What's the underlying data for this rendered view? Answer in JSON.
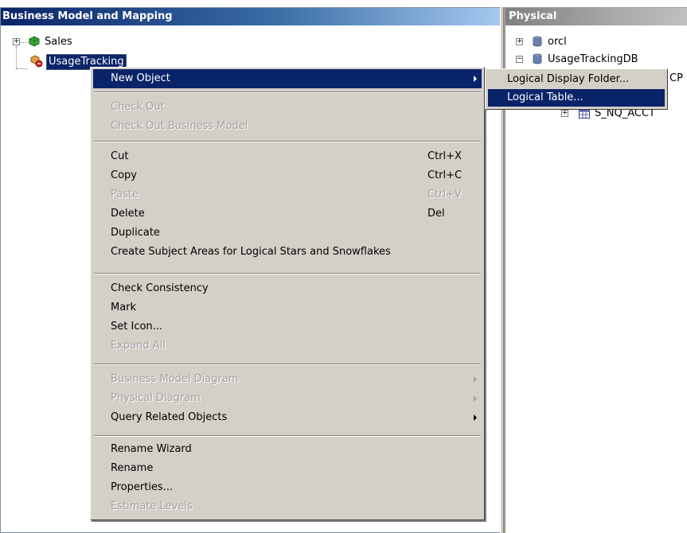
{
  "left_pane": {
    "title": "Business Model and Mapping",
    "tree": [
      {
        "label": "Sales",
        "icon": "business-model-icon"
      },
      {
        "label": "UsageTracking",
        "icon": "business-model-inconsistent-icon",
        "selected": true
      }
    ]
  },
  "right_pane": {
    "title": "Physical",
    "tree": [
      {
        "label": "orcl",
        "icon": "database-icon"
      },
      {
        "label": "UsageTrackingDB",
        "icon": "database-icon"
      },
      {
        "label": "CP",
        "icon": "schema-icon"
      },
      {
        "label": "S_NQ_ACCT",
        "icon": "table-icon"
      }
    ]
  },
  "context_menu": {
    "groups": [
      [
        {
          "label": "New Object",
          "submenu": true,
          "highlighted": true
        }
      ],
      [
        {
          "label": "Check Out",
          "disabled": true
        },
        {
          "label": "Check Out Business Model",
          "disabled": true
        }
      ],
      [
        {
          "label": "Cut",
          "shortcut": "Ctrl+X"
        },
        {
          "label": "Copy",
          "shortcut": "Ctrl+C"
        },
        {
          "label": "Paste",
          "shortcut": "Ctrl+V",
          "disabled": true
        },
        {
          "label": "Delete",
          "shortcut": "Del"
        },
        {
          "label": "Duplicate"
        },
        {
          "label": "Create Subject Areas for Logical Stars and Snowflakes"
        }
      ],
      [
        {
          "label": "Check Consistency"
        },
        {
          "label": "Mark"
        },
        {
          "label": "Set Icon..."
        },
        {
          "label": "Expand All",
          "disabled": true
        }
      ],
      [
        {
          "label": "Business Model Diagram",
          "submenu": true,
          "disabled": true
        },
        {
          "label": "Physical Diagram",
          "submenu": true,
          "disabled": true
        },
        {
          "label": "Query Related Objects",
          "submenu": true
        }
      ],
      [
        {
          "label": "Rename Wizard"
        },
        {
          "label": "Rename"
        },
        {
          "label": "Properties..."
        },
        {
          "label": "Estimate Levels",
          "disabled": true
        }
      ]
    ]
  },
  "submenu": {
    "items": [
      {
        "label": "Logical Display Folder..."
      },
      {
        "label": "Logical Table...",
        "highlighted": true
      }
    ]
  },
  "colors": {
    "menu_bg": "#d4d0c8",
    "highlight": "#0a246a",
    "title_active": "#0a246a",
    "title_inactive": "#808080"
  }
}
